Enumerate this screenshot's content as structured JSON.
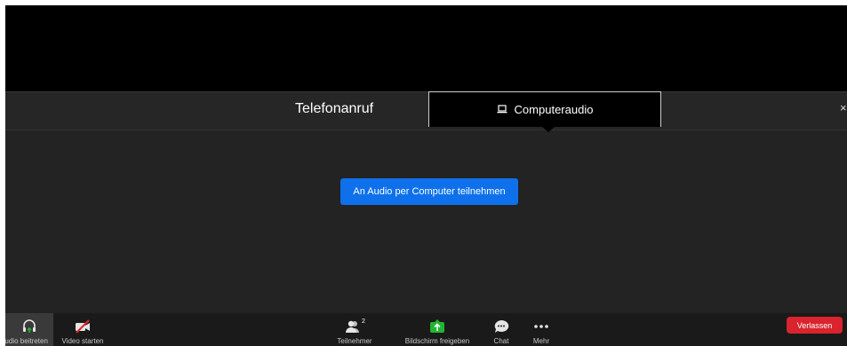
{
  "tabs": {
    "phone_label": "Telefonanruf",
    "computer_label": "Computeraudio",
    "close": "×"
  },
  "main": {
    "join_button_label": "An Audio per Computer teilnehmen"
  },
  "toolbar": {
    "audio_label": "Audio beitreten",
    "video_label": "Video starten",
    "participants_label": "Teilnehmer",
    "participants_count": "2",
    "share_label": "Bildschirm freigeben",
    "chat_label": "Chat",
    "more_label": "Mehr",
    "leave_label": "Verlassen"
  },
  "colors": {
    "accent_blue": "#0e71eb",
    "leave_red": "#d9232d",
    "share_green": "#1fb630",
    "video_off_red": "#e02828"
  }
}
